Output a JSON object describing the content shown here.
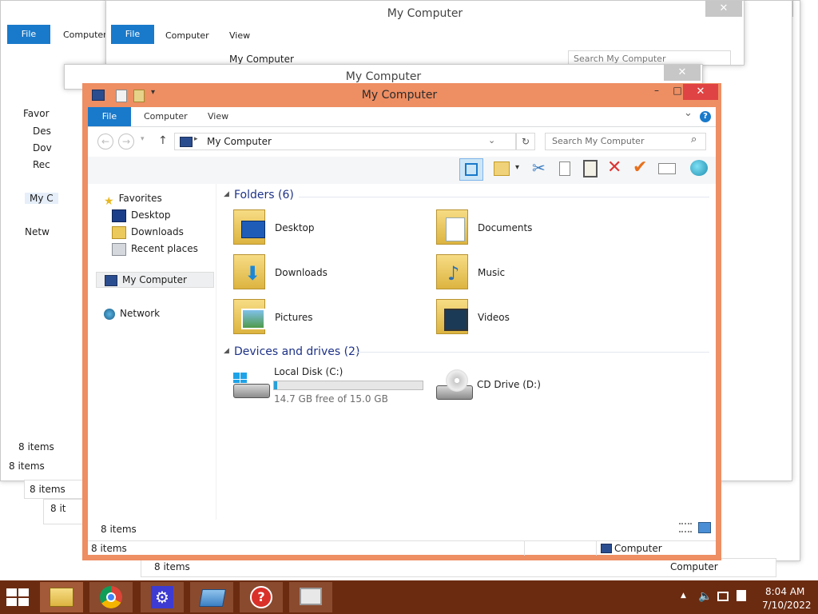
{
  "window": {
    "title": "My Computer",
    "minimize_glyph": "–",
    "maximize_glyph": "□",
    "close_glyph": "✕"
  },
  "ribbon": {
    "file": "File",
    "computer": "Computer",
    "view": "View",
    "collapse_glyph": "⌄",
    "help_glyph": "?"
  },
  "address": {
    "path": "My Computer",
    "search_placeholder": "Search My Computer",
    "back_glyph": "←",
    "forward_glyph": "→",
    "up_glyph": "↑",
    "refresh_glyph": "↻",
    "search_glyph": "⌕"
  },
  "nav": {
    "favorites": "Favorites",
    "desktop": "Desktop",
    "downloads": "Downloads",
    "recent": "Recent places",
    "mycomputer": "My Computer",
    "network": "Network"
  },
  "folders": {
    "header": "Folders (6)",
    "items": [
      "Desktop",
      "Documents",
      "Downloads",
      "Music",
      "Pictures",
      "Videos"
    ]
  },
  "drives": {
    "header": "Devices and drives (2)",
    "local_name": "Local Disk (C:)",
    "local_free": "14.7 GB free of 15.0 GB",
    "local_used_fraction": 0.02,
    "cd_name": "CD Drive (D:)"
  },
  "status": {
    "items_count": "8 items",
    "computer": "Computer"
  },
  "background": {
    "items_count": "8 items",
    "file": "File",
    "computer": "Computer",
    "view": "View",
    "path": "My Computer",
    "search": "Search My Computer",
    "favor": "Favor",
    "des": "Des",
    "dov": "Dov",
    "rec": "Rec",
    "myc": "My C",
    "netw": "Netw",
    "items_trunc": "8 it"
  },
  "tray": {
    "time": "8:04 AM",
    "date": "7/10/2022",
    "up_glyph": "▲"
  },
  "colors": {
    "accent": "#1979ca",
    "frame": "#ee8e63",
    "taskbar": "#6b2b11",
    "close": "#e04343"
  }
}
